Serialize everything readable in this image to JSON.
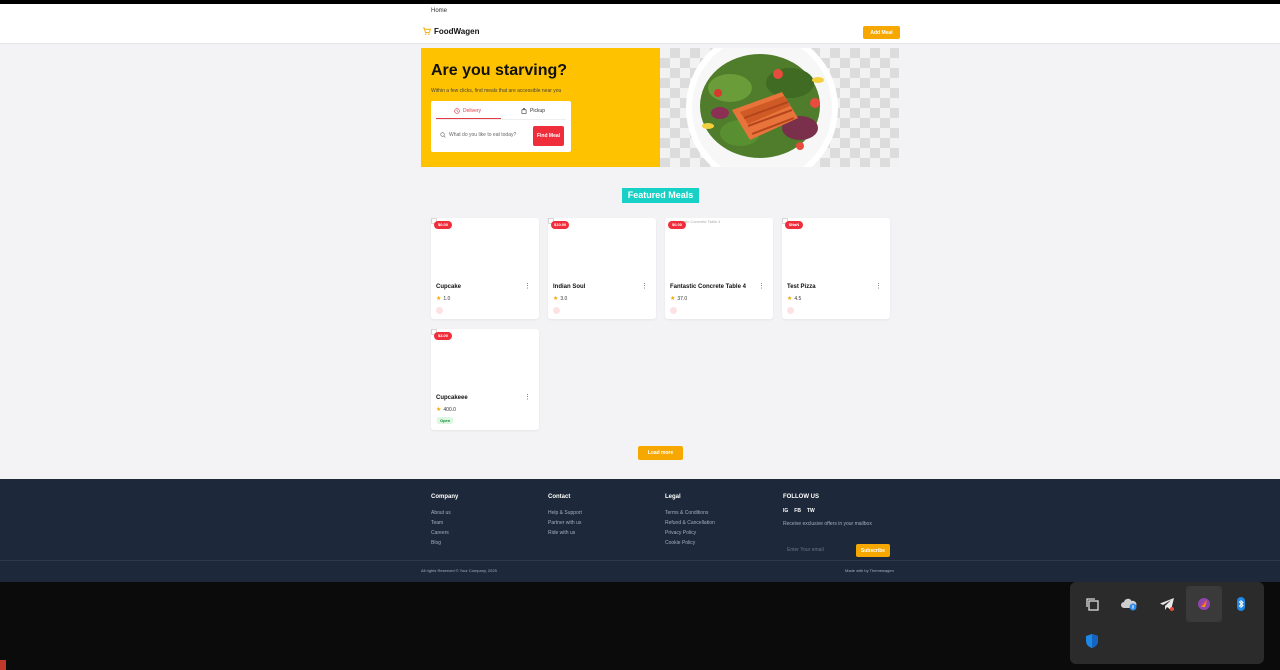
{
  "breadcrumb": {
    "home": "Home"
  },
  "nav": {
    "brand": "FoodWagen",
    "add_meal": "Add Meal"
  },
  "hero": {
    "title": "Are you starving?",
    "subtitle": "Within a few clicks, find meals that are accessible near you",
    "tabs": {
      "delivery": "Delivery",
      "pickup": "Pickup"
    },
    "search_placeholder": "What do you like to eat today?",
    "find_meal": "Find Meal"
  },
  "featured": {
    "title": "Featured Meals"
  },
  "meals": [
    {
      "price": "$0.00",
      "name": "Cupcake",
      "rating": "1.0"
    },
    {
      "price": "$10.00",
      "name": "Indian Soul",
      "rating": "3.0"
    },
    {
      "price": "$0.00",
      "name": "Fantastic Concrete Table 4",
      "rating": "37.0",
      "broken_alt": "Fantastic Concrete Table 4"
    },
    {
      "price": "$NaN",
      "name": "Test Pizza",
      "rating": "4.5"
    },
    {
      "price": "$3.00",
      "name": "Cupcakeee",
      "rating": "400.0",
      "status": "Open"
    }
  ],
  "load_more": "Load more",
  "footer": {
    "company": {
      "title": "Company",
      "links": [
        "About us",
        "Team",
        "Careers",
        "Blog"
      ]
    },
    "contact": {
      "title": "Contact",
      "links": [
        "Help & Support",
        "Partner with us",
        "Ride with us"
      ]
    },
    "legal": {
      "title": "Legal",
      "links": [
        "Terms & Conditions",
        "Refund & Cancellation",
        "Privacy Policy",
        "Cookie Policy"
      ]
    },
    "follow": {
      "title": "FOLLOW US",
      "social": [
        "IG",
        "FB",
        "TW"
      ],
      "text": "Receive exclusive offers in your mailbox",
      "email_placeholder": "Enter Your email",
      "subscribe": "Subscribe"
    },
    "copyright": "All rights Reserved © Your Company, 2025",
    "made_with": "Made with by Themewagen"
  },
  "tray_icons": [
    "copy-icon",
    "onedrive-icon",
    "telegram-icon",
    "color-app-icon",
    "bluetooth-icon",
    "defender-icon"
  ]
}
